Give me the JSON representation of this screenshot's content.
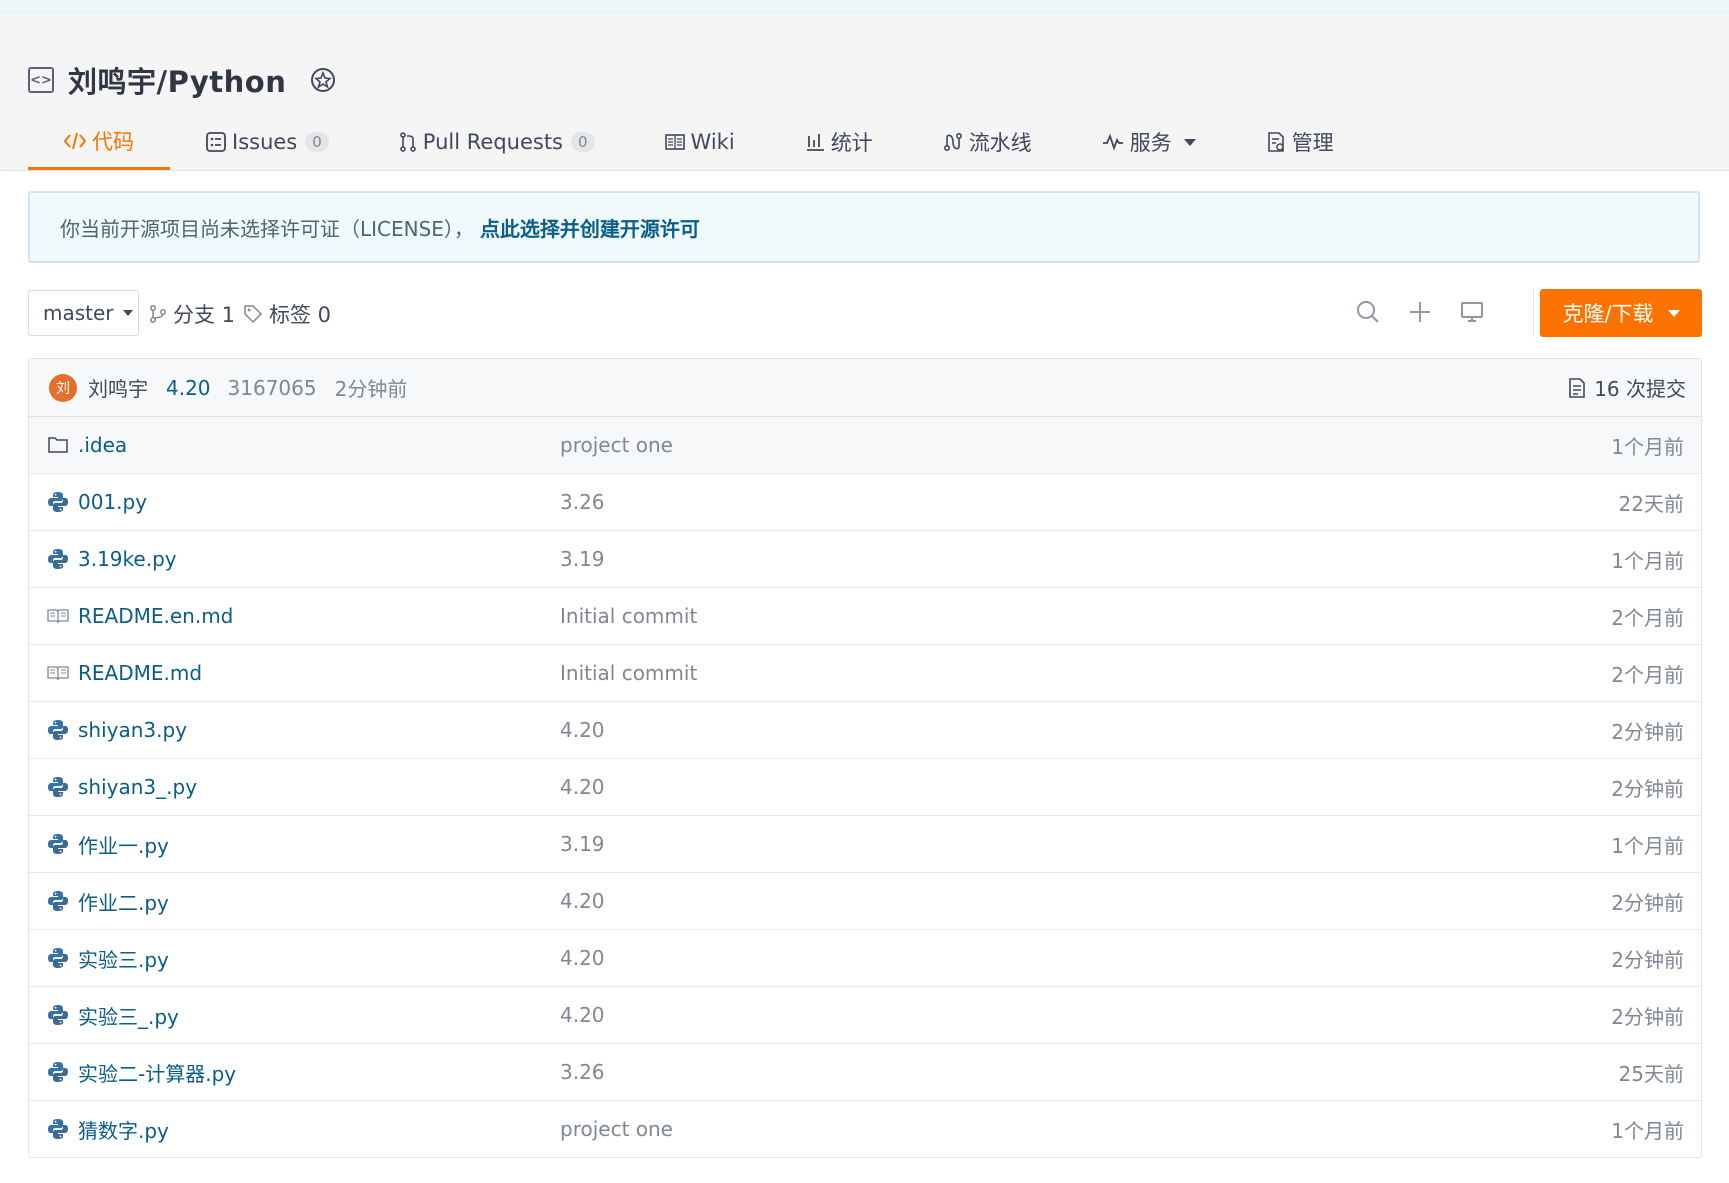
{
  "repo": {
    "title": "刘鸣宇/Python",
    "icon": "code-square-icon",
    "badge_icon": "award-badge-icon"
  },
  "tabs": [
    {
      "label": "代码",
      "icon": "code-icon",
      "active": true
    },
    {
      "label": "Issues",
      "icon": "issues-icon",
      "count": "0"
    },
    {
      "label": "Pull Requests",
      "icon": "pull-request-icon",
      "count": "0"
    },
    {
      "label": "Wiki",
      "icon": "wiki-icon"
    },
    {
      "label": "统计",
      "icon": "stats-icon"
    },
    {
      "label": "流水线",
      "icon": "pipeline-icon"
    },
    {
      "label": "服务",
      "icon": "pulse-icon",
      "dropdown": true
    },
    {
      "label": "管理",
      "icon": "manage-icon"
    }
  ],
  "notice": {
    "text": "你当前开源项目尚未选择许可证（LICENSE），",
    "link": "点此选择并创建开源许可"
  },
  "toolbar": {
    "branch": "master",
    "branches_label": "分支 1",
    "tags_label": "标签 0",
    "clone_label": "克隆/下载"
  },
  "commit": {
    "avatar_text": "刘",
    "author": "刘鸣宇",
    "message": "4.20",
    "sha": "3167065",
    "time": "2分钟前",
    "commits_label": "16 次提交"
  },
  "files": [
    {
      "name": ".idea",
      "message": "project one",
      "time": "1个月前",
      "icon": "folder-icon"
    },
    {
      "name": "001.py",
      "message": "3.26",
      "time": "22天前",
      "icon": "python-icon"
    },
    {
      "name": "3.19ke.py",
      "message": "3.19",
      "time": "1个月前",
      "icon": "python-icon"
    },
    {
      "name": "README.en.md",
      "message": "Initial commit",
      "time": "2个月前",
      "icon": "book-icon"
    },
    {
      "name": "README.md",
      "message": "Initial commit",
      "time": "2个月前",
      "icon": "book-icon"
    },
    {
      "name": "shiyan3.py",
      "message": "4.20",
      "time": "2分钟前",
      "icon": "python-icon"
    },
    {
      "name": "shiyan3_.py",
      "message": "4.20",
      "time": "2分钟前",
      "icon": "python-icon"
    },
    {
      "name": "作业一.py",
      "message": "3.19",
      "time": "1个月前",
      "icon": "python-icon"
    },
    {
      "name": "作业二.py",
      "message": "4.20",
      "time": "2分钟前",
      "icon": "python-icon"
    },
    {
      "name": "实验三.py",
      "message": "4.20",
      "time": "2分钟前",
      "icon": "python-icon"
    },
    {
      "name": "实验三_.py",
      "message": "4.20",
      "time": "2分钟前",
      "icon": "python-icon"
    },
    {
      "name": "实验二-计算器.py",
      "message": "3.26",
      "time": "25天前",
      "icon": "python-icon"
    },
    {
      "name": "猜数字.py",
      "message": "project one",
      "time": "1个月前",
      "icon": "python-icon"
    }
  ],
  "colors": {
    "accent": "#fe7300",
    "link": "#0a5d87",
    "muted": "#808694"
  }
}
